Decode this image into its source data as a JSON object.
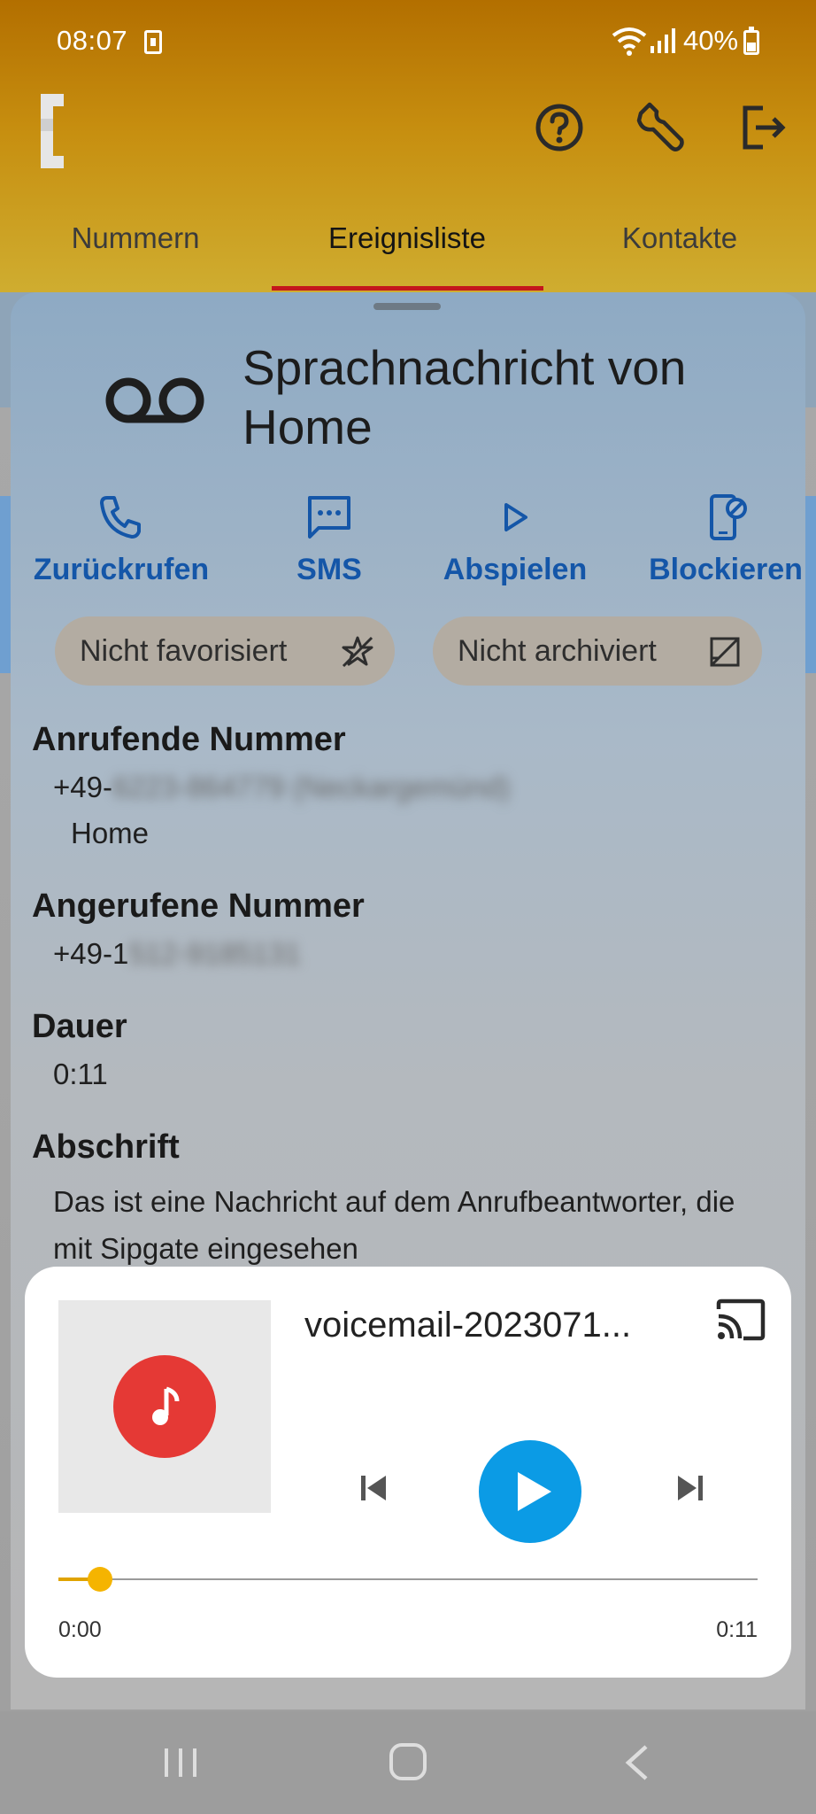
{
  "status_bar": {
    "time": "08:07",
    "battery": "40%"
  },
  "tabs": [
    {
      "label": "Nummern"
    },
    {
      "label": "Ereignisliste"
    },
    {
      "label": "Kontakte"
    }
  ],
  "sheet": {
    "title": "Sprachnachricht von Home",
    "actions": [
      {
        "label": "Zurückrufen",
        "icon": "phone-icon"
      },
      {
        "label": "SMS",
        "icon": "sms-icon"
      },
      {
        "label": "Abspielen",
        "icon": "play-icon"
      },
      {
        "label": "Blockieren",
        "icon": "block-phone-icon"
      }
    ],
    "chips": [
      {
        "label": "Nicht favorisiert",
        "icon": "star-off-icon"
      },
      {
        "label": "Nicht archiviert",
        "icon": "archive-off-icon"
      }
    ],
    "caller": {
      "heading": "Anrufende Nummer",
      "prefix": "+49-",
      "redacted": "6223-864779 (Neckargemünd)",
      "name": "Home"
    },
    "called": {
      "heading": "Angerufene Nummer",
      "prefix": "+49-1",
      "redacted": "512-9185131"
    },
    "duration": {
      "heading": "Dauer",
      "value": "0:11"
    },
    "transcript": {
      "heading": "Abschrift",
      "text": "Das ist eine Nachricht auf dem Anrufbeantworter, die mit Sipgate eingesehen"
    }
  },
  "player": {
    "title": "voicemail-2023071...",
    "current_time": "0:00",
    "total_time": "0:11",
    "progress_fraction": 0.06
  },
  "colors": {
    "accent": "#c4161c",
    "action_blue": "#1456a8",
    "play_blue": "#0b9be5",
    "art_red": "#e53935",
    "seek_yellow": "#f5b400"
  }
}
